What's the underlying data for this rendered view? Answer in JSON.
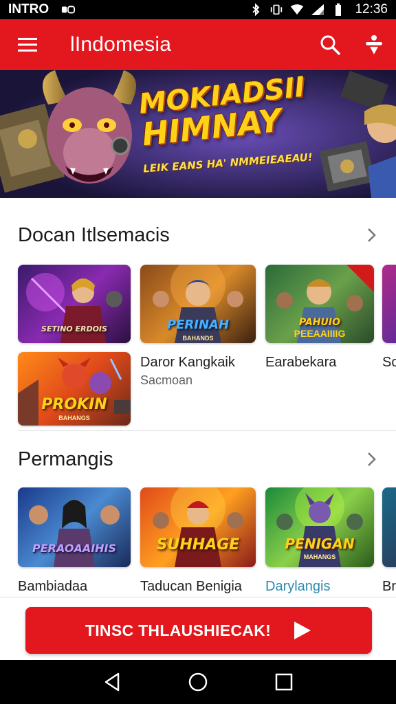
{
  "status_bar": {
    "carrier": "INTRO",
    "carrier_icon": "sim-icon",
    "time": "12:36",
    "icons": [
      "bluetooth-icon",
      "vibrate-icon",
      "wifi-icon",
      "signal-icon",
      "battery-icon"
    ]
  },
  "app_bar": {
    "title": "lIndomesia",
    "menu_icon": "menu-icon",
    "search_icon": "search-icon",
    "profile_icon": "profile-icon",
    "background": "#e3171e"
  },
  "banner": {
    "title_line1": "MOKIADSII",
    "title_line2": "HIMNAY",
    "subtitle": "LEIK EANS HA' NMMEIEAEAU!"
  },
  "sections": [
    {
      "title": "Docan Itlsemacis",
      "chevron_icon": "chevron-right-icon",
      "cards": [
        {
          "logo": "SETINO ERDOIS",
          "logo_sub": ""
        },
        {
          "logo": "PERINAH",
          "logo_sub": "BAHANDS"
        },
        {
          "logo": "PAHUIO",
          "logo_sub": "PEEAAIIIIG"
        },
        {
          "logo": "PROKIN",
          "logo_sub": "BAHANGS"
        }
      ],
      "items": [
        {
          "title": "Daror Kangkaik",
          "subtitle": "Sacmoan"
        },
        {
          "title": "Earabekara",
          "subtitle": ""
        },
        {
          "title": "Sc",
          "subtitle": ""
        }
      ]
    },
    {
      "title": "Permangis",
      "chevron_icon": "chevron-right-icon",
      "cards": [
        {
          "logo": "PERAOAAIHIS",
          "logo_sub": ""
        },
        {
          "logo": "SUHHAGE",
          "logo_sub": ""
        },
        {
          "logo": "PENIGAN",
          "logo_sub": "MAHANGS"
        }
      ],
      "items": [
        {
          "title": "Bambiadaa",
          "subtitle": ""
        },
        {
          "title": "Taducan Benigia",
          "subtitle": ""
        },
        {
          "title": "Darylangis",
          "subtitle": ""
        },
        {
          "title": "Br",
          "subtitle": ""
        }
      ]
    }
  ],
  "cta": {
    "label": "TINSC THLAUSHIECAK!",
    "play_icon": "play-icon",
    "background": "#e3171e"
  },
  "nav_bar": {
    "back_icon": "back-icon",
    "home_icon": "home-icon",
    "recents_icon": "recents-icon"
  }
}
